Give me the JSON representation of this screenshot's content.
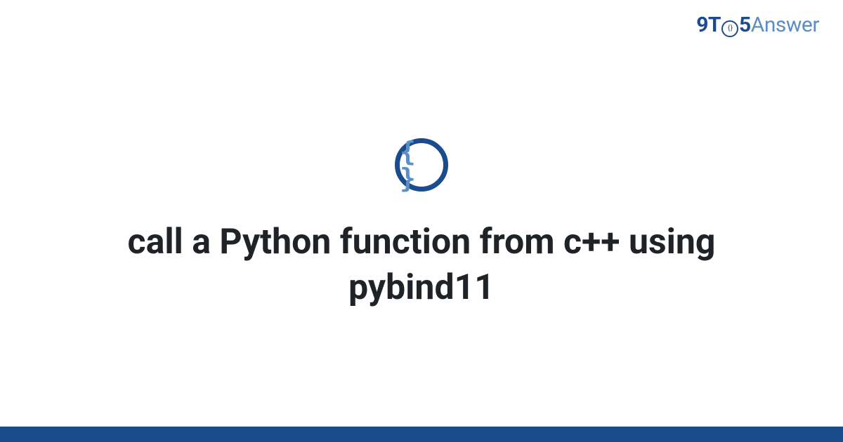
{
  "brand": {
    "part1": "9T",
    "clock_inner": "{ }",
    "part2": "5",
    "part3": "Answer"
  },
  "icon": {
    "glyph": "{ }"
  },
  "title": "call a Python function from c++ using pybind11",
  "colors": {
    "primary": "#1a4b8c",
    "secondary": "#5b8ec4",
    "text": "#1f2328"
  }
}
